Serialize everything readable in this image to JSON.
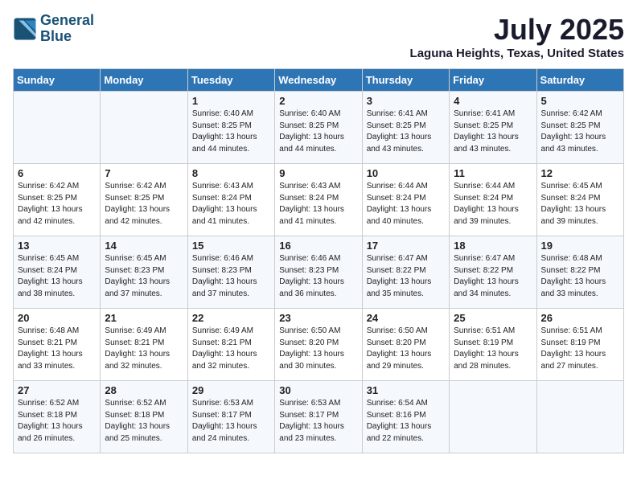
{
  "logo": {
    "line1": "General",
    "line2": "Blue"
  },
  "title": "July 2025",
  "location": "Laguna Heights, Texas, United States",
  "weekdays": [
    "Sunday",
    "Monday",
    "Tuesday",
    "Wednesday",
    "Thursday",
    "Friday",
    "Saturday"
  ],
  "weeks": [
    [
      {
        "day": "",
        "info": ""
      },
      {
        "day": "",
        "info": ""
      },
      {
        "day": "1",
        "info": "Sunrise: 6:40 AM\nSunset: 8:25 PM\nDaylight: 13 hours\nand 44 minutes."
      },
      {
        "day": "2",
        "info": "Sunrise: 6:40 AM\nSunset: 8:25 PM\nDaylight: 13 hours\nand 44 minutes."
      },
      {
        "day": "3",
        "info": "Sunrise: 6:41 AM\nSunset: 8:25 PM\nDaylight: 13 hours\nand 43 minutes."
      },
      {
        "day": "4",
        "info": "Sunrise: 6:41 AM\nSunset: 8:25 PM\nDaylight: 13 hours\nand 43 minutes."
      },
      {
        "day": "5",
        "info": "Sunrise: 6:42 AM\nSunset: 8:25 PM\nDaylight: 13 hours\nand 43 minutes."
      }
    ],
    [
      {
        "day": "6",
        "info": "Sunrise: 6:42 AM\nSunset: 8:25 PM\nDaylight: 13 hours\nand 42 minutes."
      },
      {
        "day": "7",
        "info": "Sunrise: 6:42 AM\nSunset: 8:25 PM\nDaylight: 13 hours\nand 42 minutes."
      },
      {
        "day": "8",
        "info": "Sunrise: 6:43 AM\nSunset: 8:24 PM\nDaylight: 13 hours\nand 41 minutes."
      },
      {
        "day": "9",
        "info": "Sunrise: 6:43 AM\nSunset: 8:24 PM\nDaylight: 13 hours\nand 41 minutes."
      },
      {
        "day": "10",
        "info": "Sunrise: 6:44 AM\nSunset: 8:24 PM\nDaylight: 13 hours\nand 40 minutes."
      },
      {
        "day": "11",
        "info": "Sunrise: 6:44 AM\nSunset: 8:24 PM\nDaylight: 13 hours\nand 39 minutes."
      },
      {
        "day": "12",
        "info": "Sunrise: 6:45 AM\nSunset: 8:24 PM\nDaylight: 13 hours\nand 39 minutes."
      }
    ],
    [
      {
        "day": "13",
        "info": "Sunrise: 6:45 AM\nSunset: 8:24 PM\nDaylight: 13 hours\nand 38 minutes."
      },
      {
        "day": "14",
        "info": "Sunrise: 6:45 AM\nSunset: 8:23 PM\nDaylight: 13 hours\nand 37 minutes."
      },
      {
        "day": "15",
        "info": "Sunrise: 6:46 AM\nSunset: 8:23 PM\nDaylight: 13 hours\nand 37 minutes."
      },
      {
        "day": "16",
        "info": "Sunrise: 6:46 AM\nSunset: 8:23 PM\nDaylight: 13 hours\nand 36 minutes."
      },
      {
        "day": "17",
        "info": "Sunrise: 6:47 AM\nSunset: 8:22 PM\nDaylight: 13 hours\nand 35 minutes."
      },
      {
        "day": "18",
        "info": "Sunrise: 6:47 AM\nSunset: 8:22 PM\nDaylight: 13 hours\nand 34 minutes."
      },
      {
        "day": "19",
        "info": "Sunrise: 6:48 AM\nSunset: 8:22 PM\nDaylight: 13 hours\nand 33 minutes."
      }
    ],
    [
      {
        "day": "20",
        "info": "Sunrise: 6:48 AM\nSunset: 8:21 PM\nDaylight: 13 hours\nand 33 minutes."
      },
      {
        "day": "21",
        "info": "Sunrise: 6:49 AM\nSunset: 8:21 PM\nDaylight: 13 hours\nand 32 minutes."
      },
      {
        "day": "22",
        "info": "Sunrise: 6:49 AM\nSunset: 8:21 PM\nDaylight: 13 hours\nand 32 minutes."
      },
      {
        "day": "23",
        "info": "Sunrise: 6:50 AM\nSunset: 8:20 PM\nDaylight: 13 hours\nand 30 minutes."
      },
      {
        "day": "24",
        "info": "Sunrise: 6:50 AM\nSunset: 8:20 PM\nDaylight: 13 hours\nand 29 minutes."
      },
      {
        "day": "25",
        "info": "Sunrise: 6:51 AM\nSunset: 8:19 PM\nDaylight: 13 hours\nand 28 minutes."
      },
      {
        "day": "26",
        "info": "Sunrise: 6:51 AM\nSunset: 8:19 PM\nDaylight: 13 hours\nand 27 minutes."
      }
    ],
    [
      {
        "day": "27",
        "info": "Sunrise: 6:52 AM\nSunset: 8:18 PM\nDaylight: 13 hours\nand 26 minutes."
      },
      {
        "day": "28",
        "info": "Sunrise: 6:52 AM\nSunset: 8:18 PM\nDaylight: 13 hours\nand 25 minutes."
      },
      {
        "day": "29",
        "info": "Sunrise: 6:53 AM\nSunset: 8:17 PM\nDaylight: 13 hours\nand 24 minutes."
      },
      {
        "day": "30",
        "info": "Sunrise: 6:53 AM\nSunset: 8:17 PM\nDaylight: 13 hours\nand 23 minutes."
      },
      {
        "day": "31",
        "info": "Sunrise: 6:54 AM\nSunset: 8:16 PM\nDaylight: 13 hours\nand 22 minutes."
      },
      {
        "day": "",
        "info": ""
      },
      {
        "day": "",
        "info": ""
      }
    ]
  ]
}
